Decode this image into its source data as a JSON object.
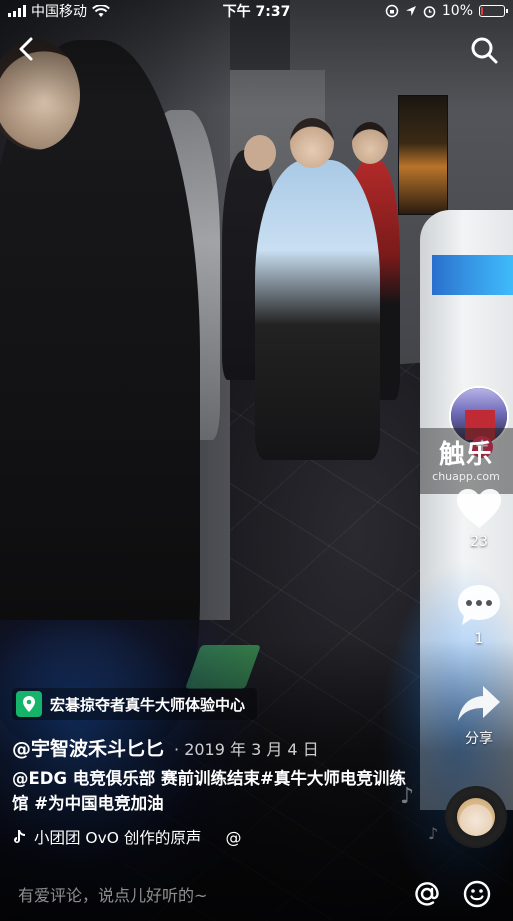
{
  "status_bar": {
    "carrier": "中国移动",
    "time": "下午 7:37",
    "battery_percent": "10%",
    "battery_level": 0.1,
    "battery_color": "#e23b3b"
  },
  "nav": {
    "back_icon": "chevron-left-icon",
    "search_icon": "search-icon"
  },
  "right_rail": {
    "avatar_icon": "creator-avatar",
    "follow_icon": "plus-icon",
    "like_count": "23",
    "comment_count": "1",
    "share_label": "分享",
    "watermark_logo": "触乐",
    "watermark_domain": "chuapp.com"
  },
  "video": {
    "location": "宏碁掠夺者真牛大师体验中心",
    "author": "@宇智波禾斗匕匕",
    "date": "· 2019 年 3 月 4 日",
    "description": "@EDG 电竞俱乐部 赛前训练结束#真牛大师电竞训练馆 #为中国电竞加油",
    "music": "小团团 OvO 创作的原声",
    "music_at": "@"
  },
  "comment_bar": {
    "placeholder": "有爱评论，说点儿好听的~",
    "at_icon": "at-icon",
    "emoji_icon": "emoji-icon"
  },
  "colors": {
    "accent_red": "#fe2c55",
    "location_green": "#16b36a"
  }
}
